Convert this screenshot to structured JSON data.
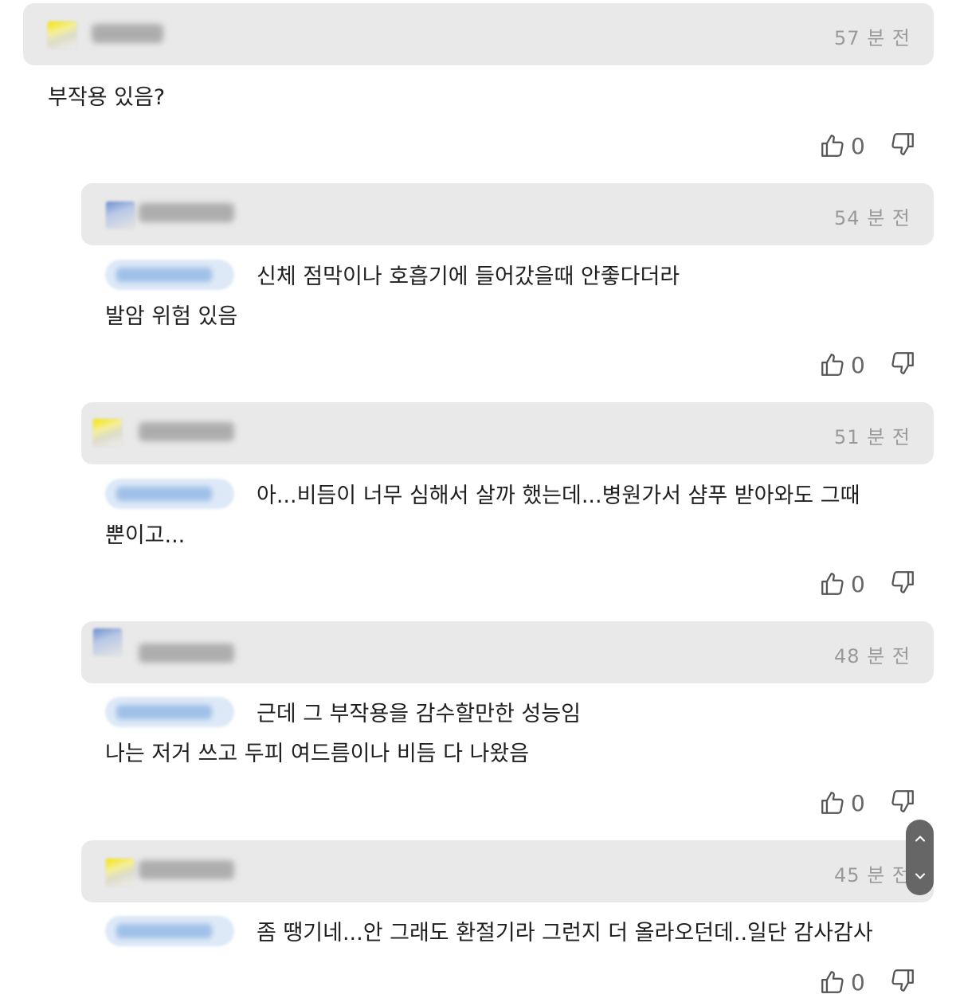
{
  "comments": [
    {
      "time": "57 분 전",
      "text": "부작용 있음?",
      "likes": "0"
    },
    {
      "time": "54 분 전",
      "text_line1": "신체 점막이나 호흡기에 들어갔을때 안좋다더라",
      "text_line2": "발암 위험 있음",
      "likes": "0"
    },
    {
      "time": "51 분 전",
      "text_line1": "아...비듬이 너무 심해서 살까 했는데...병원가서 샴푸 받아와도 그때",
      "text_line2": "뿐이고...",
      "likes": "0"
    },
    {
      "time": "48 분 전",
      "text_line1": "근데 그 부작용을 감수할만한 성능임",
      "text_line2": "나는 저거 쓰고 두피 여드름이나 비듬 다 나왔음",
      "likes": "0"
    },
    {
      "time": "45 분 전",
      "text_line1": "좀 땡기네...안 그래도 환절기라 그런지 더 올라오던데..일단 감사감사",
      "likes": "0"
    }
  ],
  "icons": {
    "like": "thumbs-up-icon",
    "dislike": "thumbs-down-icon",
    "scroll_up": "chevron-up-icon",
    "scroll_down": "chevron-down-icon"
  }
}
